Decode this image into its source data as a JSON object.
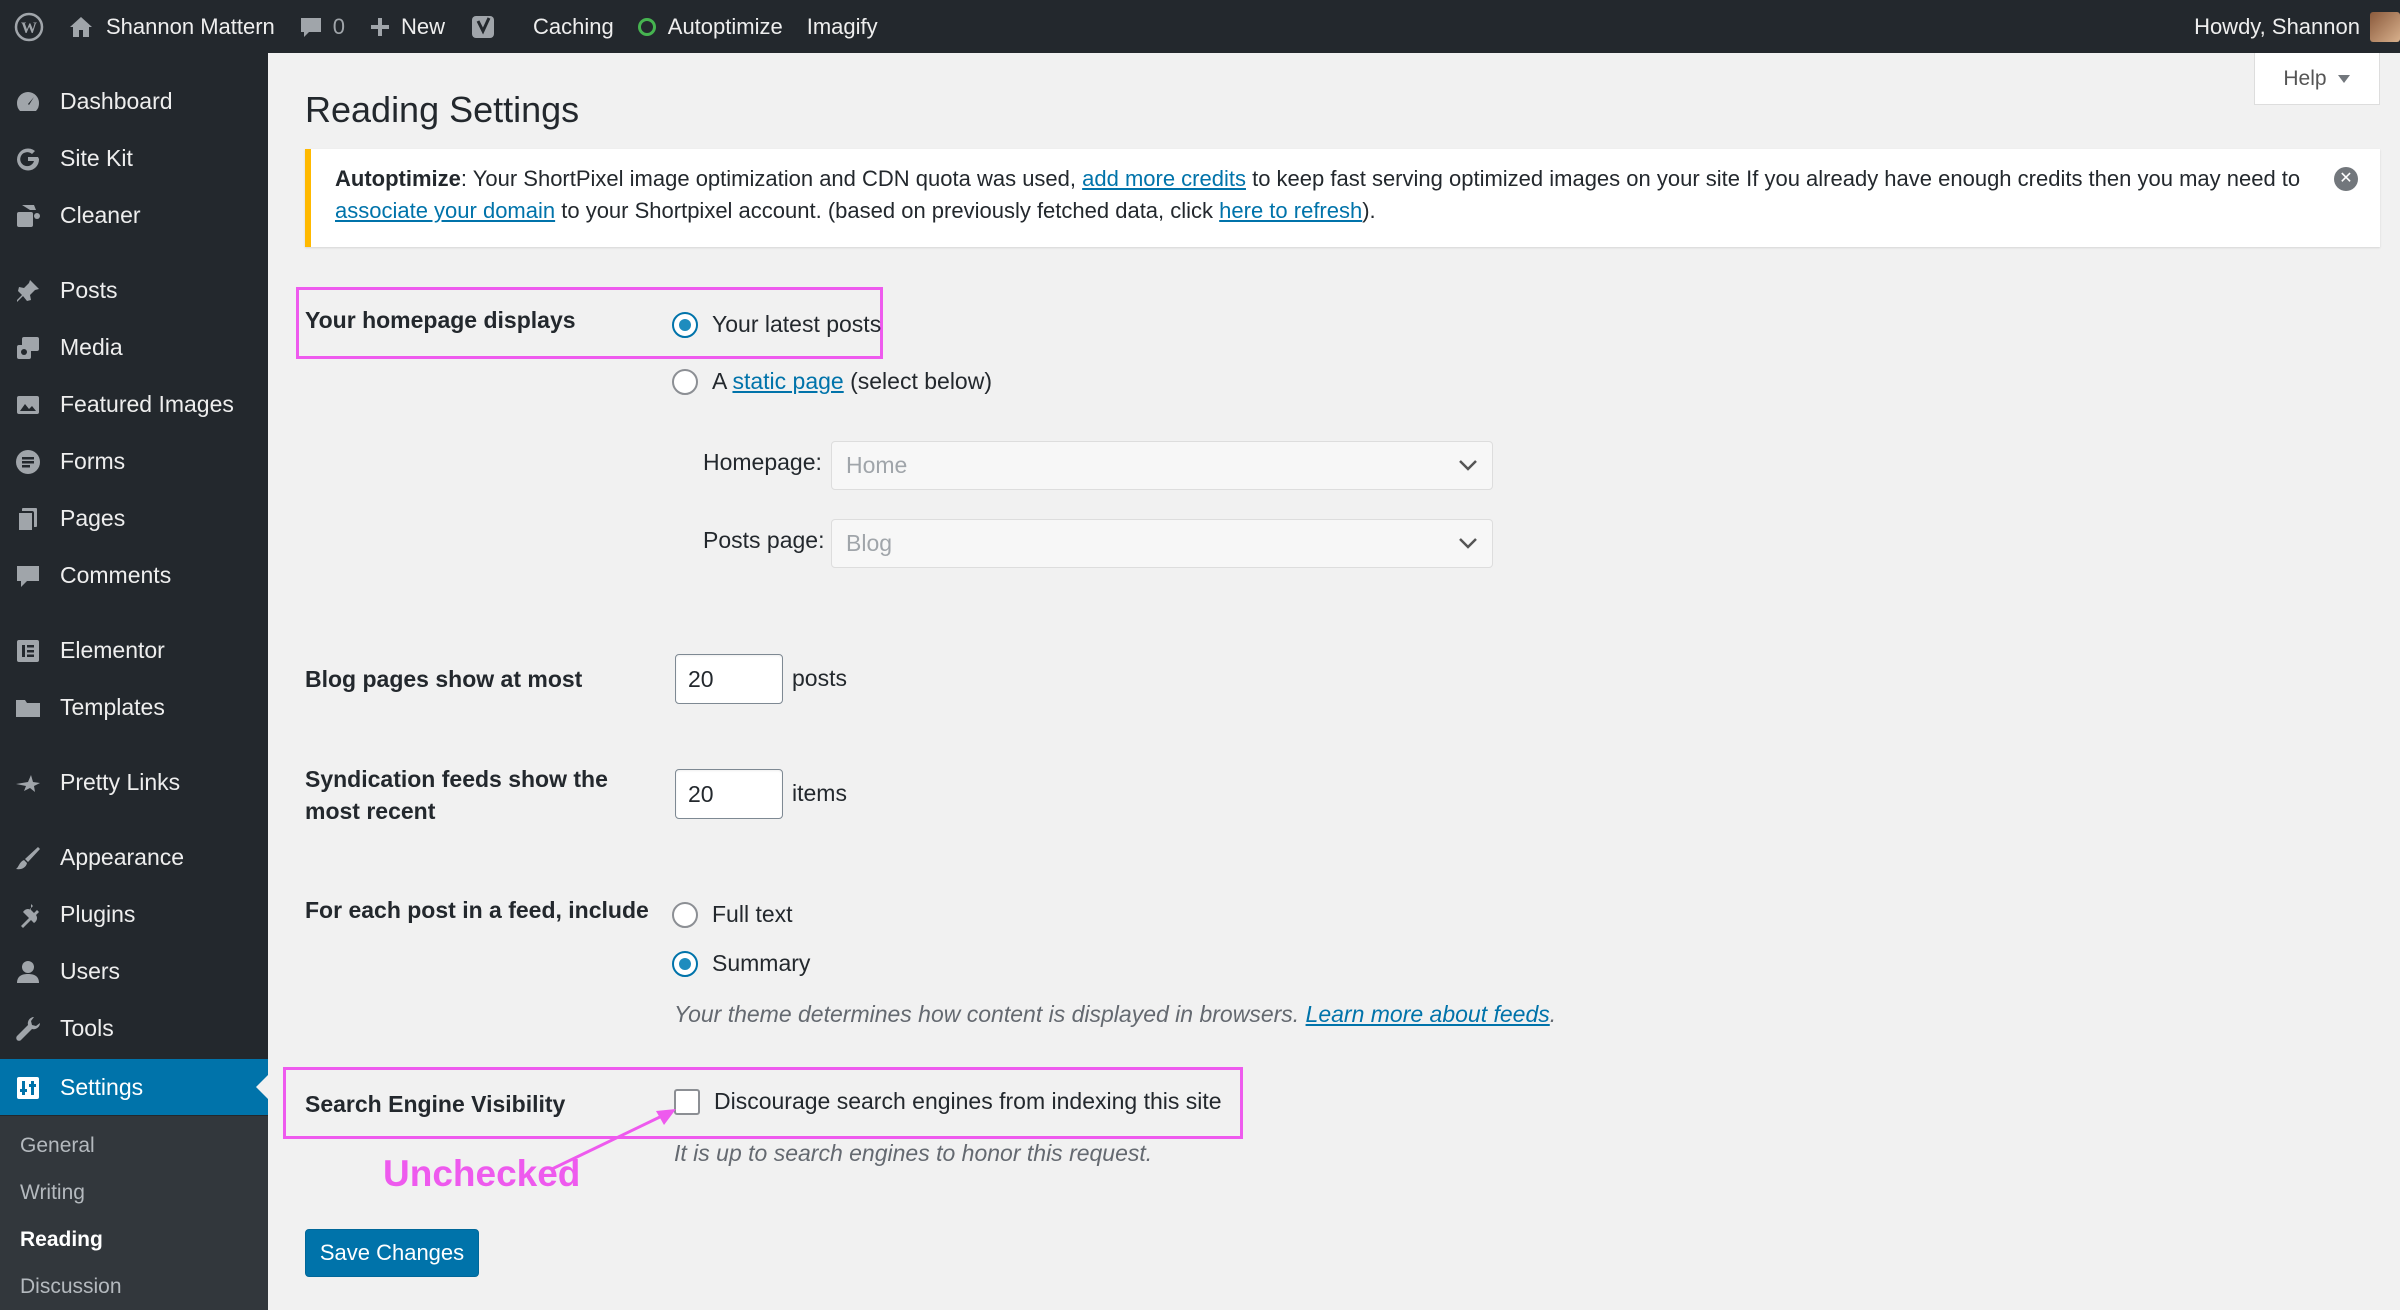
{
  "admin_bar": {
    "site_name": "Shannon Mattern",
    "comments_count": "0",
    "new_label": "New",
    "caching_label": "Caching",
    "autoptimize_label": "Autoptimize",
    "imagify_label": "Imagify",
    "greeting": "Howdy, Shannon"
  },
  "sidebar": {
    "items": [
      {
        "label": "Dashboard",
        "icon": "dashboard-icon"
      },
      {
        "label": "Site Kit",
        "icon": "google-g-icon"
      },
      {
        "label": "Cleaner",
        "icon": "cleaner-icon"
      },
      {
        "label": "Posts",
        "icon": "pushpin-icon"
      },
      {
        "label": "Media",
        "icon": "media-icon"
      },
      {
        "label": "Featured Images",
        "icon": "images-icon"
      },
      {
        "label": "Forms",
        "icon": "forms-icon"
      },
      {
        "label": "Pages",
        "icon": "pages-icon"
      },
      {
        "label": "Comments",
        "icon": "comment-icon"
      },
      {
        "label": "Elementor",
        "icon": "elementor-icon"
      },
      {
        "label": "Templates",
        "icon": "folder-icon"
      },
      {
        "label": "Pretty Links",
        "icon": "star-link-icon"
      },
      {
        "label": "Appearance",
        "icon": "paintbrush-icon"
      },
      {
        "label": "Plugins",
        "icon": "plug-icon"
      },
      {
        "label": "Users",
        "icon": "user-icon"
      },
      {
        "label": "Tools",
        "icon": "wrench-icon"
      },
      {
        "label": "Settings",
        "icon": "settings-icon"
      }
    ],
    "submenu": [
      "General",
      "Writing",
      "Reading",
      "Discussion"
    ]
  },
  "help_label": "Help",
  "page_title": "Reading Settings",
  "notice": {
    "prefix": "Autoptimize",
    "text1": ": Your ShortPixel image optimization and CDN quota was used, ",
    "link1": "add more credits",
    "text2": " to keep fast serving optimized images on your site If you already have enough credits then you may need to ",
    "link2": "associate your domain",
    "text3": " to your Shortpixel account. (based on previously fetched data, click ",
    "link3": "here to refresh",
    "text4": ")."
  },
  "homepage": {
    "label": "Your homepage displays",
    "option_latest": "Your latest posts",
    "option_static_prefix": "A ",
    "option_static_link": "static page",
    "option_static_suffix": " (select below)",
    "homepage_label": "Homepage:",
    "homepage_value": "Home",
    "posts_page_label": "Posts page:",
    "posts_page_value": "Blog"
  },
  "blog_pages": {
    "label": "Blog pages show at most",
    "value": "20",
    "unit": "posts"
  },
  "syndication": {
    "label_line1": "Syndication feeds show the",
    "label_line2": "most recent",
    "value": "20",
    "unit": "items"
  },
  "feed_content": {
    "label": "For each post in a feed, include",
    "option_full": "Full text",
    "option_summary": "Summary",
    "desc_text": "Your theme determines how content is displayed in browsers. ",
    "desc_link": "Learn more about feeds",
    "desc_end": "."
  },
  "visibility": {
    "label": "Search Engine Visibility",
    "checkbox_label": "Discourage search engines from indexing this site",
    "desc": "It is up to search engines to honor this request.",
    "checked": false
  },
  "annotation": {
    "text": "Unchecked",
    "color": "#ee5aee"
  },
  "save_label": "Save Changes",
  "colors": {
    "admin_bg": "#23282d",
    "accent": "#0073aa",
    "notice_border": "#ffb900"
  }
}
